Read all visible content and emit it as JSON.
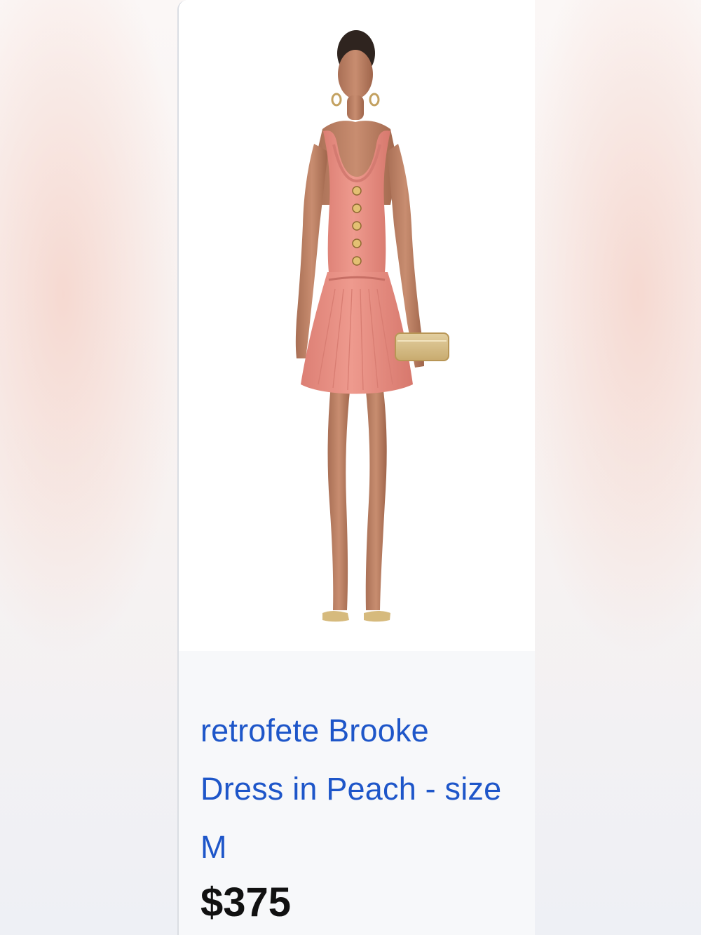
{
  "listing": {
    "image_icon": "product-photo",
    "title": "retrofete Brooke Dress in Peach - size M",
    "price": "$375"
  },
  "colors": {
    "title_link": "#1e56c9",
    "price": "#111111",
    "dress": "#ea8e83",
    "card_background": "#ffffff",
    "info_background": "#f7f8fa"
  }
}
